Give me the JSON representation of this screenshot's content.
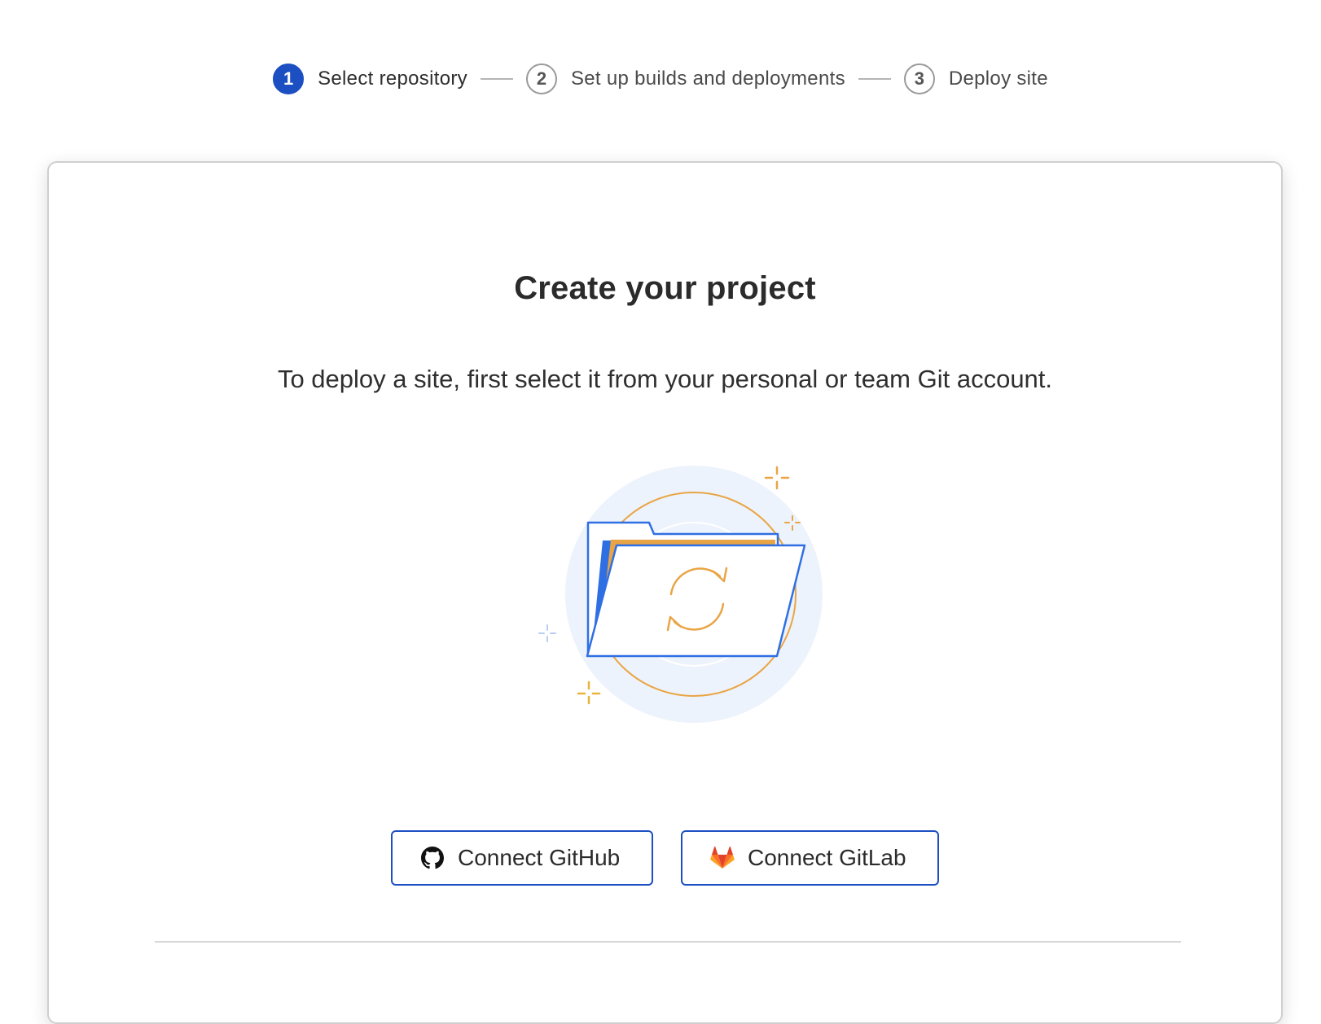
{
  "stepper": {
    "steps": [
      {
        "number": "1",
        "label": "Select repository",
        "active": true
      },
      {
        "number": "2",
        "label": "Set up builds and deployments",
        "active": false
      },
      {
        "number": "3",
        "label": "Deploy site",
        "active": false
      }
    ]
  },
  "card": {
    "title": "Create your project",
    "subtitle": "To deploy a site, first select it from your personal or team Git account.",
    "illustration_icon": "folder-sync-illustration"
  },
  "buttons": {
    "github": {
      "label": "Connect GitHub",
      "icon": "github-icon"
    },
    "gitlab": {
      "label": "Connect GitLab",
      "icon": "gitlab-icon"
    }
  },
  "colors": {
    "accent": "#1c4fc2",
    "illustration_blue": "#2f6fe4",
    "illustration_orange": "#e9a545",
    "illustration_bg": "#edf3fc"
  }
}
